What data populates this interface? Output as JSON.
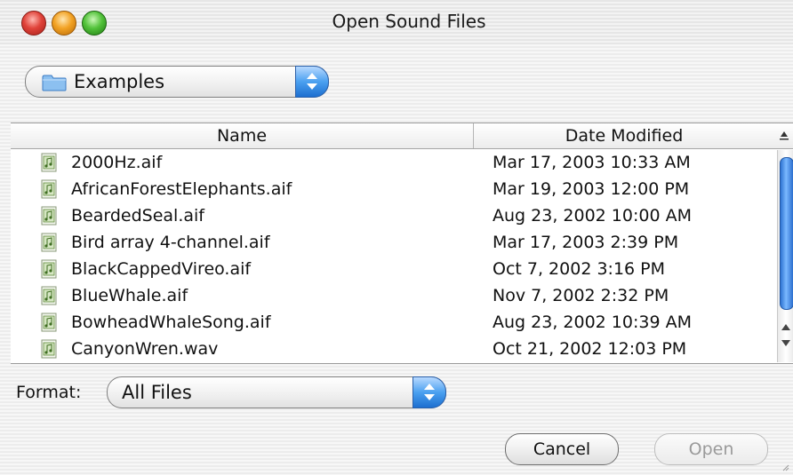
{
  "window": {
    "title": "Open Sound Files"
  },
  "location": {
    "selected": "Examples",
    "icon": "folder-icon"
  },
  "file_list": {
    "columns": [
      "Name",
      "Date Modified"
    ],
    "rows": [
      {
        "name": "2000Hz.aif",
        "date": "Mar 17, 2003 10:33 AM"
      },
      {
        "name": "AfricanForestElephants.aif",
        "date": "Mar 19, 2003 12:00 PM"
      },
      {
        "name": "BeardedSeal.aif",
        "date": "Aug 23, 2002 10:00 AM"
      },
      {
        "name": "Bird array 4-channel.aif",
        "date": "Mar 17, 2003 2:39 PM"
      },
      {
        "name": "BlackCappedVireo.aif",
        "date": "Oct 7, 2002 3:16 PM"
      },
      {
        "name": "BlueWhale.aif",
        "date": "Nov 7, 2002 2:32 PM"
      },
      {
        "name": "BowheadWhaleSong.aif",
        "date": "Aug 23, 2002 10:39 AM"
      },
      {
        "name": "CanyonWren.wav",
        "date": "Oct 21, 2002 12:03 PM"
      }
    ]
  },
  "format": {
    "label": "Format:",
    "selected": "All Files"
  },
  "buttons": {
    "cancel": "Cancel",
    "open": "Open"
  },
  "colors": {
    "accent": "#4aa0f0",
    "close": "#e0433a",
    "minimize": "#f2a224",
    "zoom": "#52c23a"
  }
}
